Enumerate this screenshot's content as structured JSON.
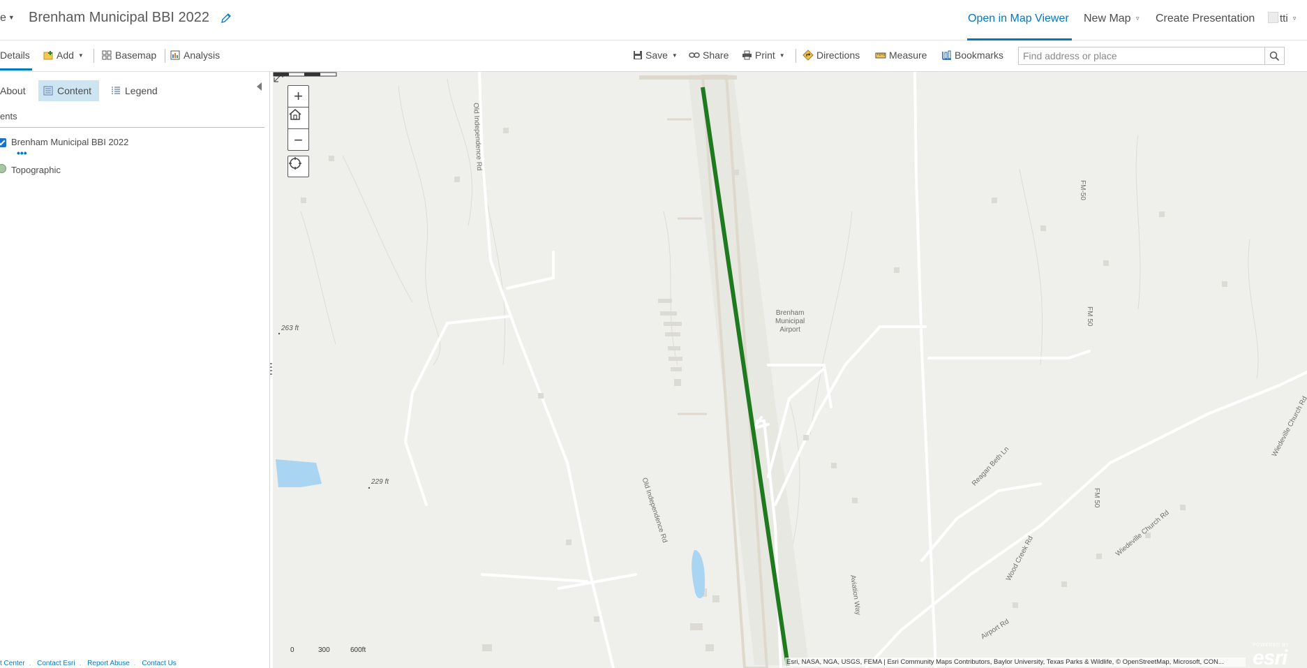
{
  "header": {
    "left_fragment": "e",
    "map_title": "Brenham Municipal BBI 2022",
    "open_in_map_viewer": "Open in Map Viewer",
    "new_map": "New Map",
    "create_presentation": "Create Presentation",
    "user": "tti"
  },
  "toolbar": {
    "details": "Details",
    "add": "Add",
    "basemap": "Basemap",
    "analysis": "Analysis",
    "save": "Save",
    "share": "Share",
    "print": "Print",
    "directions": "Directions",
    "measure": "Measure",
    "bookmarks": "Bookmarks",
    "search_placeholder": "Find address or place"
  },
  "sidepanel": {
    "tabs": {
      "about": "About",
      "content": "Content",
      "legend": "Legend"
    },
    "active_tab": "Content",
    "contents_label": "ents",
    "layers": [
      {
        "name": "Brenham Municipal BBI 2022",
        "visible": true
      },
      {
        "name": "Topographic",
        "type": "basemap"
      }
    ],
    "footer_links": [
      "t Center",
      "Contact Esri",
      "Report Abuse",
      "Contact Us"
    ]
  },
  "map": {
    "labels": {
      "airport": [
        "Brenham",
        "Municipal",
        "Airport"
      ],
      "old_independence_rd_1": "Old Independence Rd",
      "old_independence_rd_2": "Old Independence Rd",
      "fm50_a": "FM-50",
      "fm50_b": "FM 50",
      "fm50_c": "FM 50",
      "reagan_beth_ln": "Reagan Beth Ln",
      "wood_creek_rd": "Wood Creek Rd",
      "wiedeville_church_rd": "Wiedeville Church Rd",
      "wiedeville_church_rd_2": "Wiedeville Church Rd",
      "aviation_way": "Aviation Way",
      "airport_rd": "Airport Rd",
      "elev_263": "263 ft",
      "elev_229": "229 ft"
    },
    "scale": {
      "zero": "0",
      "mid": "300",
      "end": "600ft"
    },
    "attribution": "Esri, NASA, NGA, USGS, FEMA | Esri Community Maps Contributors, Baylor University, Texas Parks & Wildlife, © OpenStreetMap, Microsoft, CON...",
    "esri_powered": "POWERED BY",
    "esri_word": "esri",
    "colors": {
      "land": "#efefec",
      "runway_feature": "#1f7a1f",
      "water": "#a9d4f2",
      "road": "#ffffff",
      "accent": "#0079c1"
    }
  }
}
